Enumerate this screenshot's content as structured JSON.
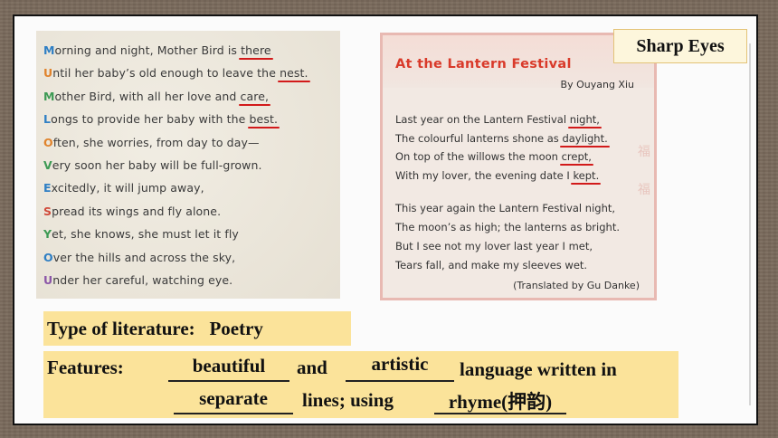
{
  "slide": {
    "sharp_eyes": "Sharp Eyes"
  },
  "poem_left": {
    "lines": [
      {
        "initial": "M",
        "rest_before": "orning and night, Mother Bird is ",
        "underlined": "there",
        "rest_after": ""
      },
      {
        "initial": "U",
        "rest_before": "ntil her baby’s old enough to leave the ",
        "underlined": "nest.",
        "rest_after": ""
      },
      {
        "initial": "M",
        "rest_before": "other Bird, with all her love and ",
        "underlined": "care,",
        "rest_after": ""
      },
      {
        "initial": "L",
        "rest_before": "ongs to provide her baby with the ",
        "underlined": "best.",
        "rest_after": ""
      },
      {
        "initial": "O",
        "rest_before": "ften, she worries, from day to day—",
        "underlined": "",
        "rest_after": ""
      },
      {
        "initial": "V",
        "rest_before": "ery soon her baby will be full-grown.",
        "underlined": "",
        "rest_after": ""
      },
      {
        "initial": "E",
        "rest_before": "xcitedly, it will jump away,",
        "underlined": "",
        "rest_after": ""
      },
      {
        "initial": "S",
        "rest_before": "pread its wings and fly alone.",
        "underlined": "",
        "rest_after": ""
      },
      {
        "initial": "Y",
        "rest_before": "et, she knows, she must let it fly",
        "underlined": "",
        "rest_after": ""
      },
      {
        "initial": "O",
        "rest_before": "ver the hills and across the sky,",
        "underlined": "",
        "rest_after": ""
      },
      {
        "initial": "U",
        "rest_before": "nder her careful, watching eye.",
        "underlined": "",
        "rest_after": ""
      }
    ]
  },
  "poem_right": {
    "title": "At the Lantern Festival",
    "author": "By Ouyang Xiu",
    "stanza1": [
      {
        "before": "Last year on the Lantern Festival ",
        "underlined": "night,"
      },
      {
        "before": "The colourful lanterns shone as ",
        "underlined": "daylight."
      },
      {
        "before": "On top of the willows the moon ",
        "underlined": "crept,"
      },
      {
        "before": "With my lover, the evening date I ",
        "underlined": "kept."
      }
    ],
    "stanza2": [
      "This year again the Lantern Festival night,",
      "The moon’s as high; the lanterns as bright.",
      "But I see not my lover last year I met,",
      "Tears fall, and make my sleeves wet."
    ],
    "credit": "(Translated by Gu Danke)",
    "deco_chars": [
      "福",
      "福"
    ]
  },
  "type_of_literature": {
    "label": "Type of literature:",
    "value": "Poetry"
  },
  "features": {
    "label": "Features:",
    "answer1": "beautiful",
    "and": "and",
    "answer2": "artistic",
    "text1": "language written in",
    "answer3": "separate",
    "text2": "lines; using",
    "answer4": "rhyme(押韵)",
    "close": ")"
  }
}
